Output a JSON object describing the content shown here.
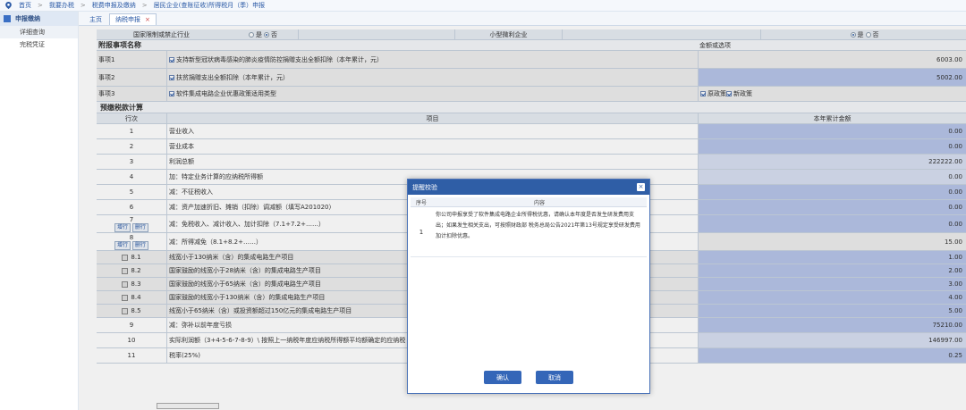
{
  "breadcrumb": [
    "首页",
    "我要办税",
    "税费申报及缴纳",
    "居民企业(查账征收)所得税月（季）申报"
  ],
  "sidebar": {
    "title": "申报缴纳",
    "items": [
      {
        "label": "详细查询"
      },
      {
        "label": "完税凭证"
      }
    ]
  },
  "tabs": [
    {
      "label": "主页"
    },
    {
      "label": "纳税申报"
    }
  ],
  "top_row": {
    "restricted_label": "国家限制或禁止行业",
    "restricted_yes": "是",
    "restricted_no": "否",
    "small_label": "小型微利企业",
    "small_yes": "是",
    "small_no": "否"
  },
  "matters": {
    "section_title": "附报事项名称",
    "right_header": "金额或选项",
    "rows": [
      {
        "id": "事项1",
        "name": "支持新型冠状病毒感染的肺炎疫情防控捐赠支出全额扣除（本年累计，元）",
        "value": "6003.00"
      },
      {
        "id": "事项2",
        "name": "扶贫捐赠支出全额扣除（本年累计，元）",
        "value": "5002.00"
      },
      {
        "id": "事项3",
        "name": "软件集成电路企业优惠政策适用类型",
        "opt1": "原政策",
        "opt2": "新政策"
      }
    ]
  },
  "calc": {
    "section_title": "预缴税款计算",
    "col_line": "行次",
    "col_item": "项目",
    "col_amount": "本年累计金额",
    "add_label": "增行",
    "del_label": "删行",
    "rows": [
      {
        "line": "1",
        "item": "营业收入",
        "value": "0.00"
      },
      {
        "line": "2",
        "item": "营业成本",
        "value": "0.00"
      },
      {
        "line": "3",
        "item": "利润总额",
        "value": "222222.00"
      },
      {
        "line": "4",
        "item": "加：特定业务计算的应纳税所得额",
        "value": "0.00"
      },
      {
        "line": "5",
        "item": "减：不征税收入",
        "value": "0.00"
      },
      {
        "line": "6",
        "item": "减：资产加速折旧、摊销（扣除）调减额（填写A201020）",
        "value": "0.00"
      },
      {
        "line": "7",
        "item": "减：免税收入、减计收入、加计扣除（7.1+7.2+……）",
        "value": "0.00"
      },
      {
        "line": "8",
        "item": "减：所得减免（8.1+8.2+……）",
        "value": "15.00"
      },
      {
        "line": "8.1",
        "item": "线宽小于130纳米（含）的集成电路生产项目",
        "value": "1.00"
      },
      {
        "line": "8.2",
        "item": "国家鼓励的线宽小于28纳米（含）的集成电路生产项目",
        "value": "2.00"
      },
      {
        "line": "8.3",
        "item": "国家鼓励的线宽小于65纳米（含）的集成电路生产项目",
        "value": "3.00"
      },
      {
        "line": "8.4",
        "item": "国家鼓励的线宽小于130纳米（含）的集成电路生产项目",
        "value": "4.00"
      },
      {
        "line": "8.5",
        "item": "线宽小于65纳米（含）或投资额超过150亿元的集成电路生产项目",
        "value": "5.00"
      },
      {
        "line": "9",
        "item": "减：弥补以前年度亏损",
        "value": "75210.00"
      },
      {
        "line": "10",
        "item": "实际利润额（3+4-5-6-7-8-9）\\ 按照上一纳税年度应纳税所得额平均额确定的应纳税",
        "value": "146997.00"
      },
      {
        "line": "11",
        "item": "税率(25%)",
        "value": "0.25"
      }
    ]
  },
  "modal": {
    "title": "提醒校验",
    "col_seq": "序号",
    "col_content": "内容",
    "seq": "1",
    "content": "你公司申报享受了软件集成电路企业所得税优惠，请确认本年度是否发生研发费用支出；如果发生相关支出，可按照财政部 税务总局公告2021年第13号规定享受研发费用加计扣除优惠。",
    "confirm": "确认",
    "cancel": "取消"
  }
}
